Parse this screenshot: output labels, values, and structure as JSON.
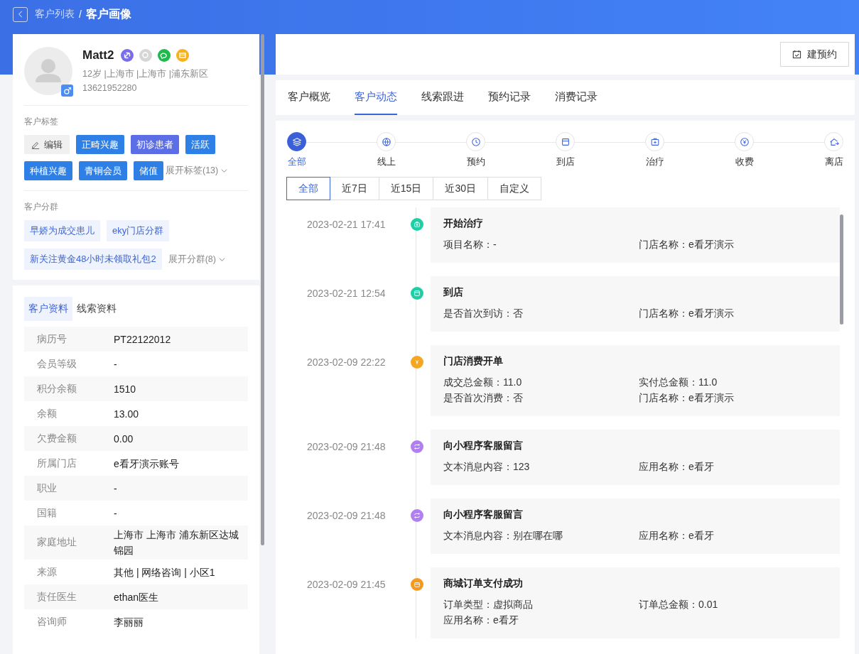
{
  "breadcrumb": {
    "items": [
      {
        "label": "客户列表",
        "current": false
      },
      {
        "label": "客户画像",
        "current": true
      }
    ],
    "separator": "/"
  },
  "profile": {
    "name": "Matt2",
    "male": true,
    "meta": "12岁 |上海市 |上海市 |浦东新区",
    "phone": "13621952280",
    "contact_icons": [
      {
        "kind": "link",
        "active": true
      },
      {
        "kind": "message",
        "active": false
      },
      {
        "kind": "wechat",
        "active": true
      },
      {
        "kind": "shop",
        "active": true
      }
    ]
  },
  "tags": {
    "title": "客户标签",
    "edit": "编辑",
    "items": [
      {
        "label": "正畸兴趣",
        "color": "#2f80e6"
      },
      {
        "label": "初诊患者",
        "color": "#5b6ee6"
      },
      {
        "label": "活跃",
        "color": "#2f80e6"
      },
      {
        "label": "种植兴趣",
        "color": "#2f80e6"
      },
      {
        "label": "青铜会员",
        "color": "#2f80e6"
      },
      {
        "label": "储值",
        "color": "#2f80e6"
      }
    ],
    "expand": "展开标签(13)"
  },
  "groups": {
    "title": "客户分群",
    "items": [
      "早娇为成交患儿",
      "eky门店分群",
      "新关注黄金48小时未领取礼包2"
    ],
    "expand": "展开分群(8)"
  },
  "info_tabs": [
    {
      "label": "客户资料",
      "selected": true
    },
    {
      "label": "线索资料",
      "selected": false
    }
  ],
  "info_rows": [
    {
      "label": "病历号",
      "value": "PT22122012"
    },
    {
      "label": "会员等级",
      "value": "-"
    },
    {
      "label": "积分余额",
      "value": "1510"
    },
    {
      "label": "余额",
      "value": "13.00"
    },
    {
      "label": "欠费金额",
      "value": "0.00"
    },
    {
      "label": "所属门店",
      "value": "e看牙演示账号"
    },
    {
      "label": "职业",
      "value": "-"
    },
    {
      "label": "国籍",
      "value": "-"
    },
    {
      "label": "家庭地址",
      "value": "上海市 上海市 浦东新区达城锦园"
    },
    {
      "label": "来源",
      "value": "其他 | 网络咨询 | 小区1"
    },
    {
      "label": "责任医生",
      "value": "ethan医生"
    },
    {
      "label": "咨询师",
      "value": "李丽丽"
    }
  ],
  "appointment_button": "建预约",
  "tabs": [
    {
      "label": "客户概览",
      "selected": false
    },
    {
      "label": "客户动态",
      "selected": true
    },
    {
      "label": "线索跟进",
      "selected": false
    },
    {
      "label": "预约记录",
      "selected": false
    },
    {
      "label": "消费记录",
      "selected": false
    }
  ],
  "event_filters": [
    {
      "kind": "all",
      "label": "全部",
      "selected": true
    },
    {
      "kind": "online",
      "label": "线上",
      "selected": false
    },
    {
      "kind": "appointment",
      "label": "预约",
      "selected": false
    },
    {
      "kind": "arrival",
      "label": "到店",
      "selected": false
    },
    {
      "kind": "treatment",
      "label": "治疗",
      "selected": false
    },
    {
      "kind": "payment",
      "label": "收费",
      "selected": false
    },
    {
      "kind": "leave",
      "label": "离店",
      "selected": false
    }
  ],
  "date_ranges": [
    {
      "label": "全部",
      "selected": true
    },
    {
      "label": "近7日",
      "selected": false
    },
    {
      "label": "近15日",
      "selected": false
    },
    {
      "label": "近30日",
      "selected": false
    },
    {
      "label": "自定义",
      "selected": false
    }
  ],
  "events": [
    {
      "time": "2023-02-21 17:41",
      "kind": "treatment",
      "title": "开始治疗",
      "fields": [
        "项目名称：-",
        "门店名称：e看牙演示"
      ]
    },
    {
      "time": "2023-02-21 12:54",
      "kind": "arrival",
      "title": "到店",
      "fields": [
        "是否首次到访：否",
        "门店名称：e看牙演示"
      ]
    },
    {
      "time": "2023-02-09 22:22",
      "kind": "payment",
      "title": "门店消费开单",
      "fields": [
        "成交总金额：11.0",
        "实付总金额：11.0",
        "是否首次消费：否",
        "门店名称：e看牙演示"
      ]
    },
    {
      "time": "2023-02-09 21:48",
      "kind": "message",
      "title": "向小程序客服留言",
      "fields": [
        "文本消息内容：123",
        "应用名称：e看牙"
      ]
    },
    {
      "time": "2023-02-09 21:48",
      "kind": "message",
      "title": "向小程序客服留言",
      "fields": [
        "文本消息内容：别在哪在哪",
        "应用名称：e看牙"
      ]
    },
    {
      "time": "2023-02-09 21:45",
      "kind": "order",
      "title": "商城订单支付成功",
      "fields": [
        "订单类型：虚拟商品",
        "订单总金额：0.01",
        "应用名称：e看牙"
      ]
    }
  ]
}
